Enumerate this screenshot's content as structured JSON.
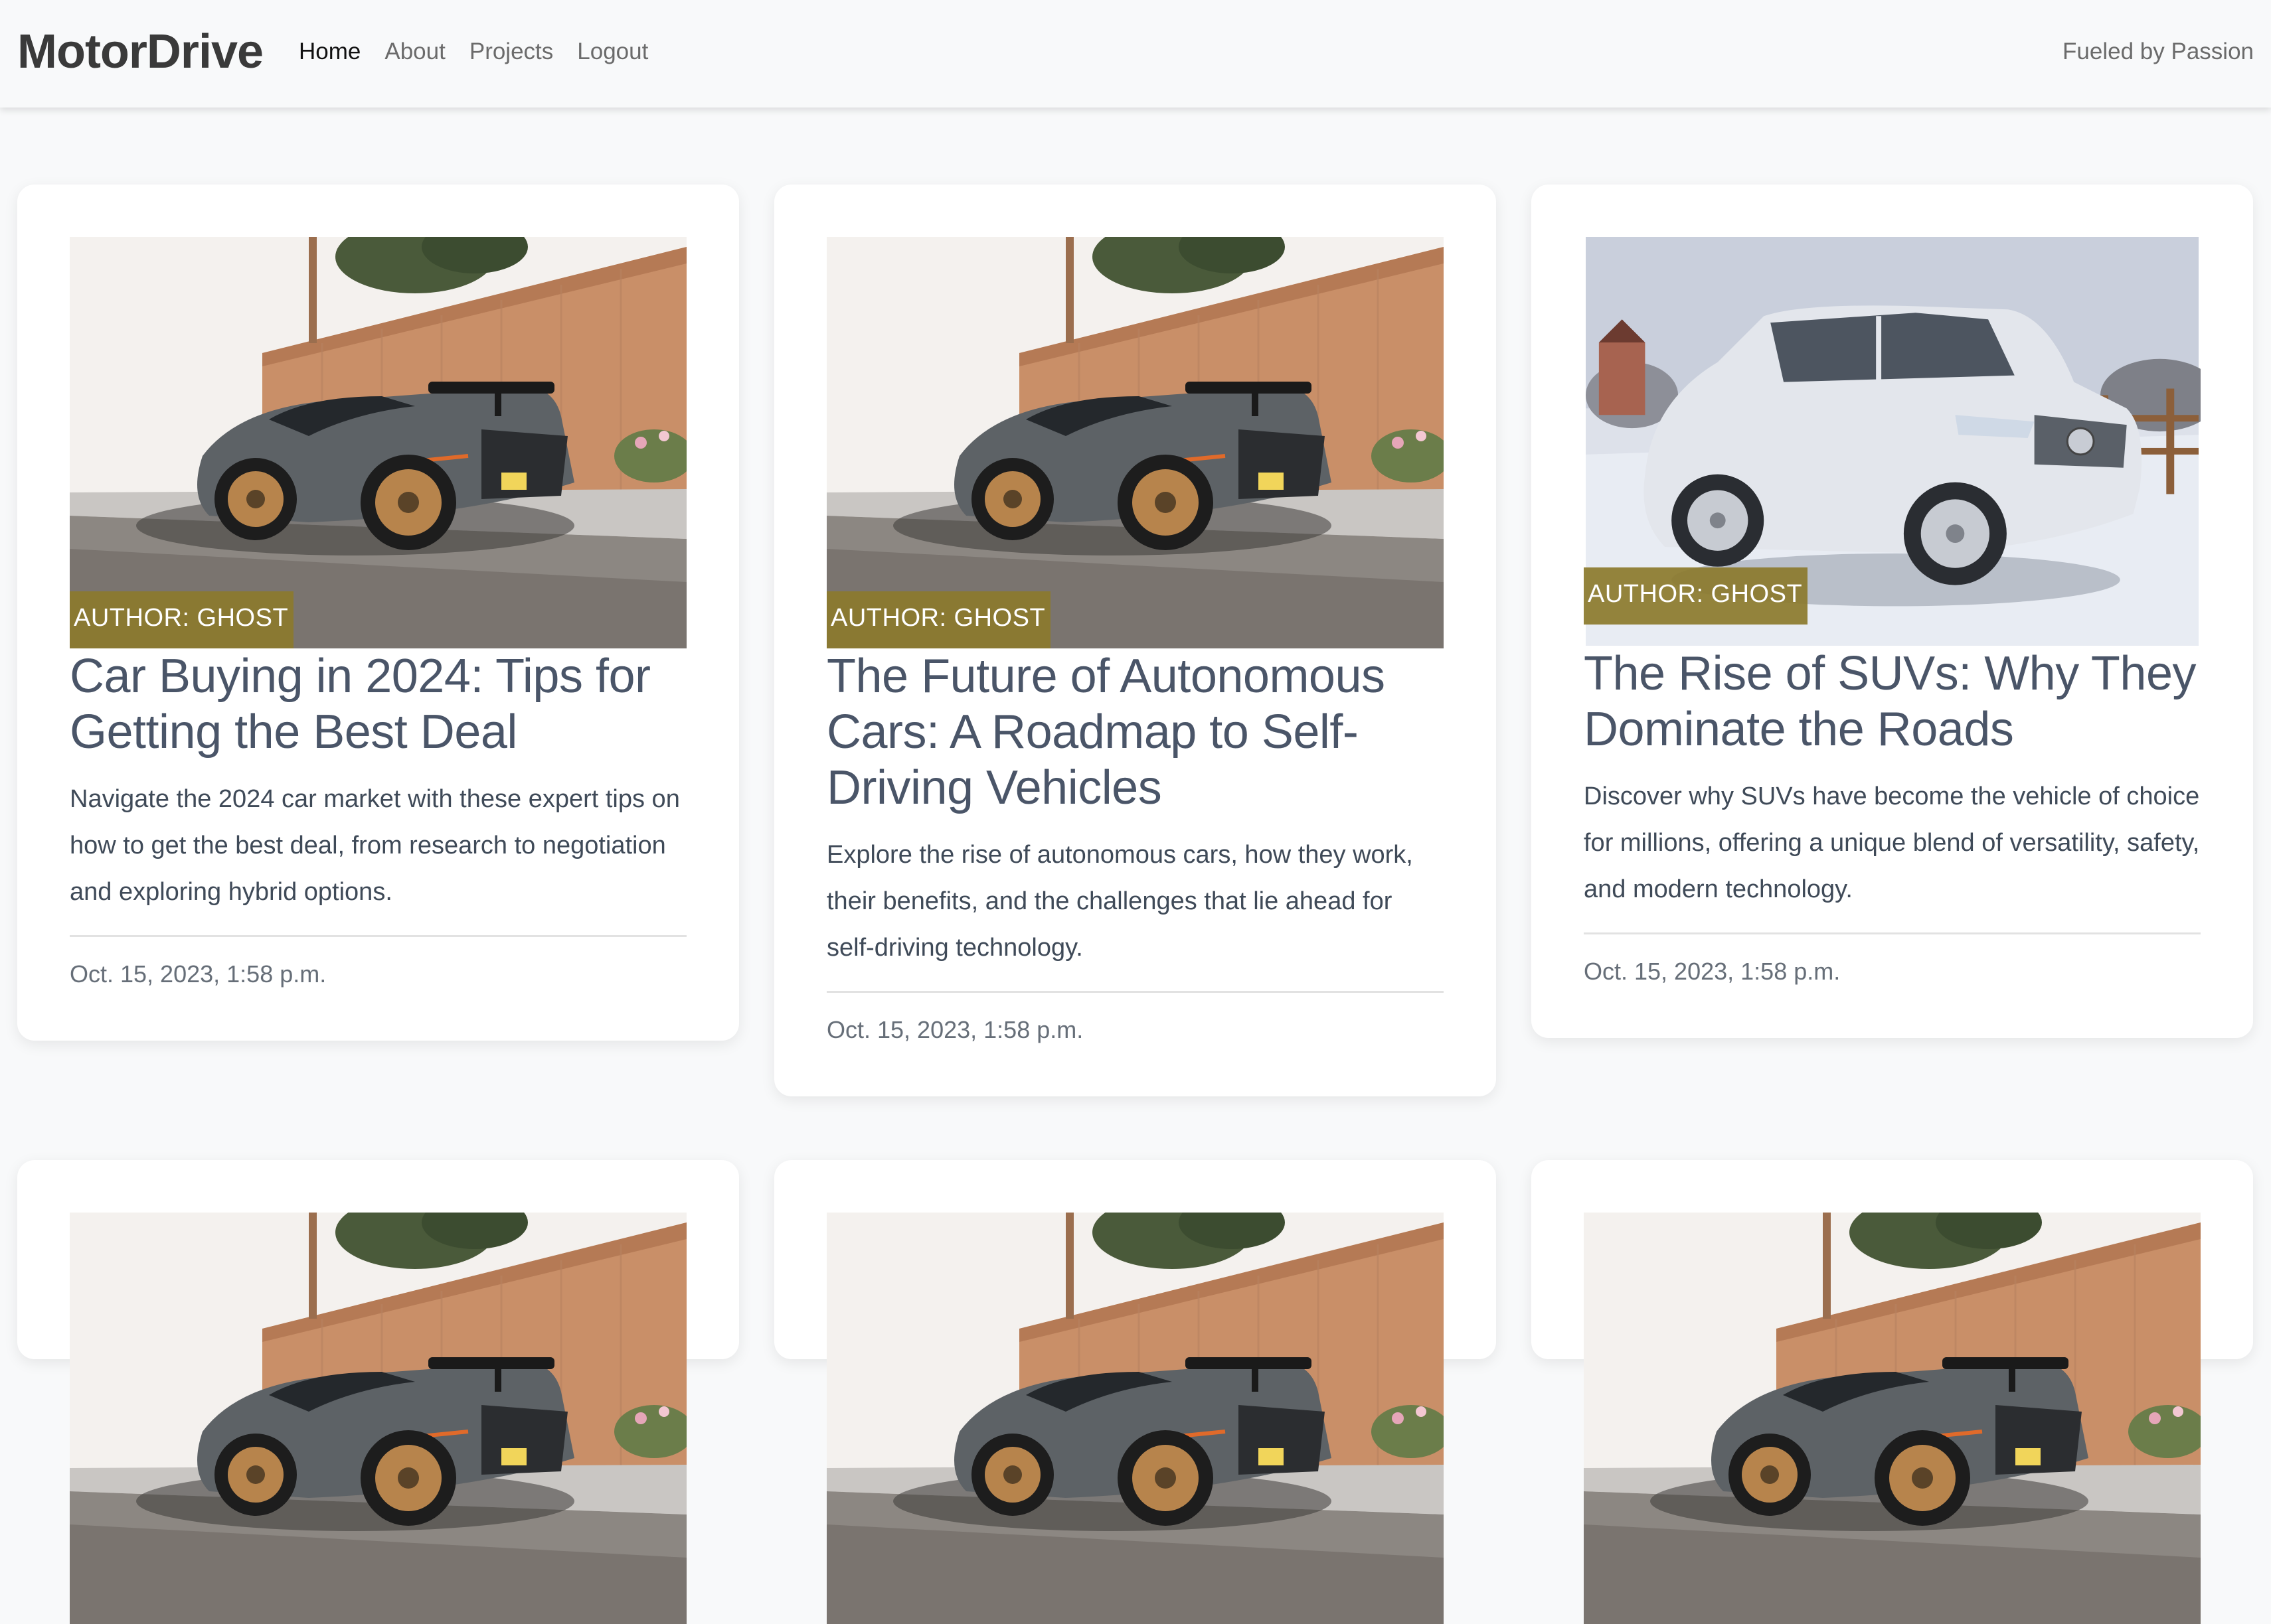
{
  "navbar": {
    "brand": "MotorDrive",
    "links": [
      {
        "label": "Home",
        "active": true
      },
      {
        "label": "About",
        "active": false
      },
      {
        "label": "Projects",
        "active": false
      },
      {
        "label": "Logout",
        "active": false
      }
    ],
    "tagline": "Fueled by Passion"
  },
  "posts": [
    {
      "image": "supercar-photo",
      "author": "AUTHOR: GHOST",
      "title": "Car Buying in 2024: Tips for Getting the Best Deal",
      "description": "Navigate the 2024 car market with these expert tips on how to get the best deal, from research to negotiation and exploring hybrid options.",
      "date": "Oct. 15, 2023, 1:58 p.m."
    },
    {
      "image": "supercar-photo",
      "author": "AUTHOR: GHOST",
      "title": "The Future of Autonomous Cars: A Roadmap to Self-Driving Vehicles",
      "description": "Explore the rise of autonomous cars, how they work, their benefits, and the challenges that lie ahead for self-driving technology.",
      "date": "Oct. 15, 2023, 1:58 p.m."
    },
    {
      "image": "suv-snow-photo",
      "author": "AUTHOR: GHOST",
      "title": "The Rise of SUVs: Why They Dominate the Roads",
      "description": "Discover why SUVs have become the vehicle of choice for millions, offering a unique blend of versatility, safety, and modern technology.",
      "date": "Oct. 15, 2023, 1:58 p.m."
    },
    {
      "image": "supercar-photo"
    },
    {
      "image": "supercar-photo"
    },
    {
      "image": "supercar-photo"
    }
  ],
  "colors": {
    "author_badge": "#8b792c",
    "title_text": "#4a5568",
    "page_background": "#f8f9fa"
  }
}
